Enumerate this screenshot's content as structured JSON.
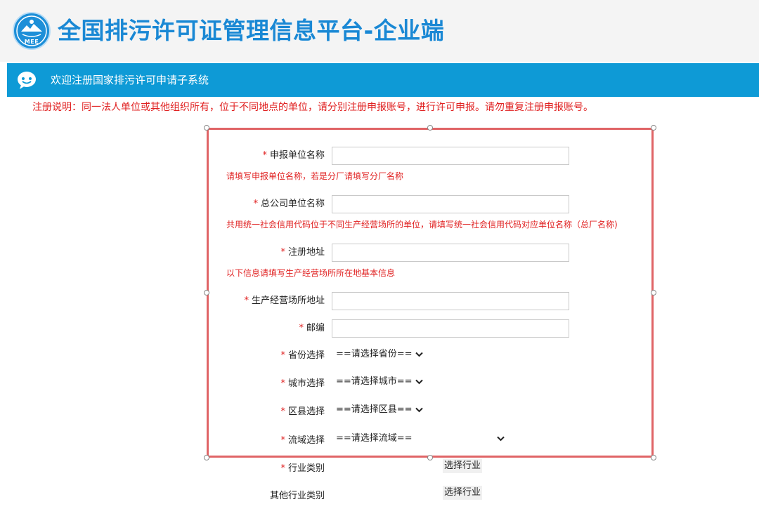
{
  "header": {
    "logo_text": "MEE",
    "title": "全国排污许可证管理信息平台-企业端"
  },
  "welcome_bar": {
    "text": "欢迎注册国家排污许可申请子系统"
  },
  "notice": "注册说明：同一法人单位或其他组织所有，位于不同地点的单位，请分别注册申报账号，进行许可申报。请勿重复注册申报账号。",
  "form": {
    "required_mark": "*",
    "fields": {
      "unit_name": {
        "label": "申报单位名称",
        "value": "",
        "hint": "请填写申报单位名称，若是分厂请填写分厂名称"
      },
      "parent_name": {
        "label": "总公司单位名称",
        "value": "",
        "hint": "共用统一社会信用代码位于不同生产经营场所的单位，请填写统一社会信用代码对应单位名称（总厂名称)"
      },
      "reg_address": {
        "label": "注册地址",
        "value": "",
        "hint": "以下信息请填写生产经营场所所在地基本信息"
      },
      "site_address": {
        "label": "生产经营场所地址",
        "value": ""
      },
      "postcode": {
        "label": "邮编",
        "value": ""
      },
      "province": {
        "label": "省份选择",
        "selected": "==请选择省份=="
      },
      "city": {
        "label": "城市选择",
        "selected": "==请选择城市=="
      },
      "county": {
        "label": "区县选择",
        "selected": "==请选择区县=="
      },
      "basin": {
        "label": "流域选择",
        "selected": "==请选择流域=="
      },
      "industry": {
        "label": "行业类别",
        "button": "选择行业"
      },
      "other_industry": {
        "label": "其他行业类别",
        "button": "选择行业"
      }
    }
  },
  "colors": {
    "brand_blue": "#1a88d4",
    "bar_blue": "#0e9ad6",
    "required_red": "#e02020",
    "frame_red": "#e06466"
  },
  "icons": {
    "logo": "mee-emblem-icon",
    "welcome": "chat-bubble-icon",
    "dropdown": "chevron-down-icon"
  }
}
